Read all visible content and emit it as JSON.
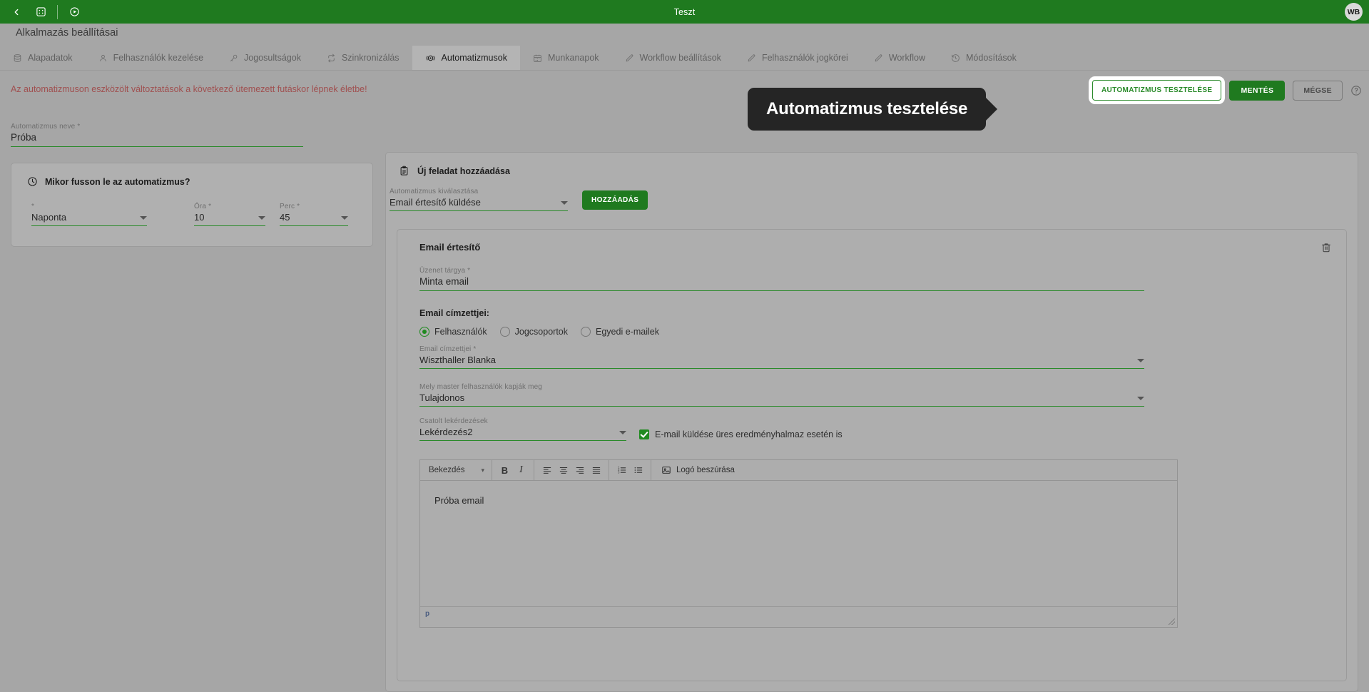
{
  "topbar": {
    "title": "Teszt",
    "back_icon": "chevron-left-icon",
    "apps_icon": "grid-apps-icon",
    "play_icon": "play-circle-icon",
    "avatar_initials": "WB",
    "background": "#1f7a1f"
  },
  "page": {
    "title": "Alkalmazás beállításai"
  },
  "tabs": [
    {
      "label": "Alapadatok",
      "icon": "database-icon",
      "active": false
    },
    {
      "label": "Felhasználók kezelése",
      "icon": "user-icon",
      "active": false
    },
    {
      "label": "Jogosultságok",
      "icon": "key-icon",
      "active": false
    },
    {
      "label": "Szinkronizálás",
      "icon": "sync-icon",
      "active": false
    },
    {
      "label": "Automatizmusok",
      "icon": "automation-gear-icon",
      "active": true
    },
    {
      "label": "Munkanapok",
      "icon": "calendar-icon",
      "active": false
    },
    {
      "label": "Workflow beállítások",
      "icon": "pencil-icon",
      "active": false
    },
    {
      "label": "Felhasználók jogkörei",
      "icon": "pencil-icon",
      "active": false
    },
    {
      "label": "Workflow",
      "icon": "pencil-icon",
      "active": false
    },
    {
      "label": "Módosítások",
      "icon": "history-icon",
      "active": false
    }
  ],
  "alert": {
    "message": "Az automatizmuson eszközölt változtatások a következő ütemezett futáskor lépnek életbe!",
    "color": "#a05050"
  },
  "actions": {
    "test_label": "AUTOMATIZMUS TESZTELÉSE",
    "save_label": "MENTÉS",
    "cancel_label": "MÉGSE",
    "help_icon": "question-circle-icon",
    "accent": "#1f7a1f"
  },
  "callout": {
    "text": "Automatizmus tesztelése",
    "background": "#252525"
  },
  "automation_name": {
    "label": "Automatizmus neve",
    "required_mark": "*",
    "value": "Próba"
  },
  "schedule": {
    "heading": "Mikor fusson le az automatizmus?",
    "heading_icon": "clock-icon",
    "frequency": {
      "label": "",
      "required_mark": "*",
      "value": "Naponta"
    },
    "hour": {
      "label": "Óra",
      "required_mark": "*",
      "value": "10"
    },
    "minute": {
      "label": "Perc",
      "required_mark": "*",
      "value": "45"
    }
  },
  "main_panel": {
    "heading": "Új feladat hozzáadása",
    "heading_icon": "clipboard-icon",
    "automation_select": {
      "label": "Automatizmus kiválasztása",
      "value": "Email értesítő küldése"
    },
    "add_button_label": "HOZZÁADÁS"
  },
  "task": {
    "title": "Email értesítő",
    "delete_icon": "trash-icon",
    "subject": {
      "label": "Üzenet tárgya",
      "required_mark": "*",
      "value": "Minta email"
    },
    "recipients_heading": "Email címzettjei:",
    "recipient_types": [
      {
        "label": "Felhasználók",
        "selected": true
      },
      {
        "label": "Jogcsoportok",
        "selected": false
      },
      {
        "label": "Egyedi e-mailek",
        "selected": false
      }
    ],
    "recipients": {
      "label": "Email címzettjei",
      "required_mark": "*",
      "value": "Wiszthaller Blanka"
    },
    "master_users": {
      "label": "Mely master felhasználók kapják meg",
      "value": "Tulajdonos"
    },
    "attached_query": {
      "label": "Csatolt lekérdezések",
      "value": "Lekérdezés2"
    },
    "empty_result_checkbox": {
      "label": "E-mail küldése üres eredményhalmaz esetén is",
      "checked": true
    }
  },
  "editor": {
    "format_select_value": "Bekezdés",
    "bold_label": "B",
    "italic_label": "I",
    "buttons": [
      "align-left-icon",
      "align-center-icon",
      "align-right-icon",
      "align-justify-icon",
      "ordered-list-icon",
      "unordered-list-icon"
    ],
    "insert_logo_label": "Logó beszúrása",
    "insert_logo_icon": "image-icon",
    "body_text": "Próba email",
    "status_path": "p"
  }
}
